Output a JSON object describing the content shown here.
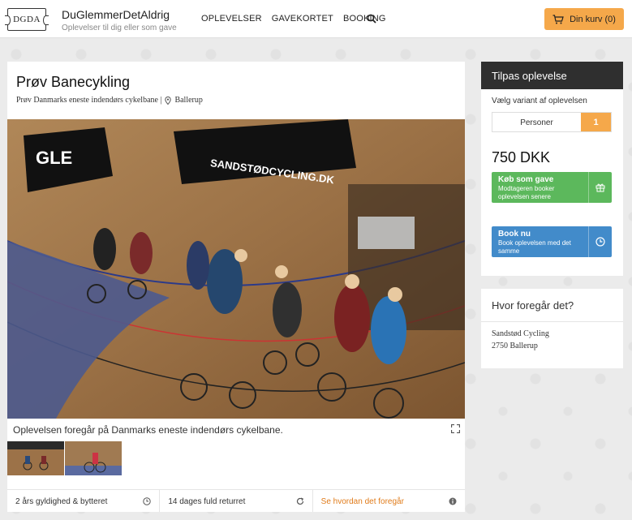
{
  "header": {
    "logo_text": "DGDA",
    "brand_name": "DuGlemmerDetAldrig",
    "brand_sub": "Oplevelser til dig eller som gave",
    "nav": [
      "OPLEVELSER",
      "GAVEKORTET",
      "BOOKING"
    ],
    "cart_label": "Din kurv (0)",
    "cart_color": "#f5a84a"
  },
  "main": {
    "title": "Prøv Banecykling",
    "subtitle": "Prøv Danmarks eneste indendørs cykelbane |",
    "location": "Ballerup",
    "hero_banner_text": "SANDSTØDCYCLING.DK",
    "caption": "Oplevelsen foregår på Danmarks eneste indendørs cykelbane.",
    "info": [
      {
        "label": "2 års gyldighed & bytteret",
        "icon": "clock-icon"
      },
      {
        "label": "14 dages fuld returret",
        "icon": "refresh-icon"
      },
      {
        "label": "Se hvordan det foregår",
        "icon": "info-icon"
      }
    ]
  },
  "sidebar": {
    "heading": "Tilpas oplevelse",
    "variant_label": "Vælg variant af oplevelsen",
    "persons_label": "Personer",
    "persons_count": "1",
    "price": "750 DKK",
    "gift_button": {
      "title": "Køb som gave",
      "sub": "Modtageren booker oplevelsen senere",
      "color": "#5cb85c"
    },
    "book_button": {
      "title": "Book nu",
      "sub": "Book oplevelsen med det samme",
      "color": "#428bca"
    }
  },
  "where": {
    "title": "Hvor foregår det?",
    "address_line1": "Sandstød Cycling",
    "address_line2": "2750 Ballerup"
  }
}
